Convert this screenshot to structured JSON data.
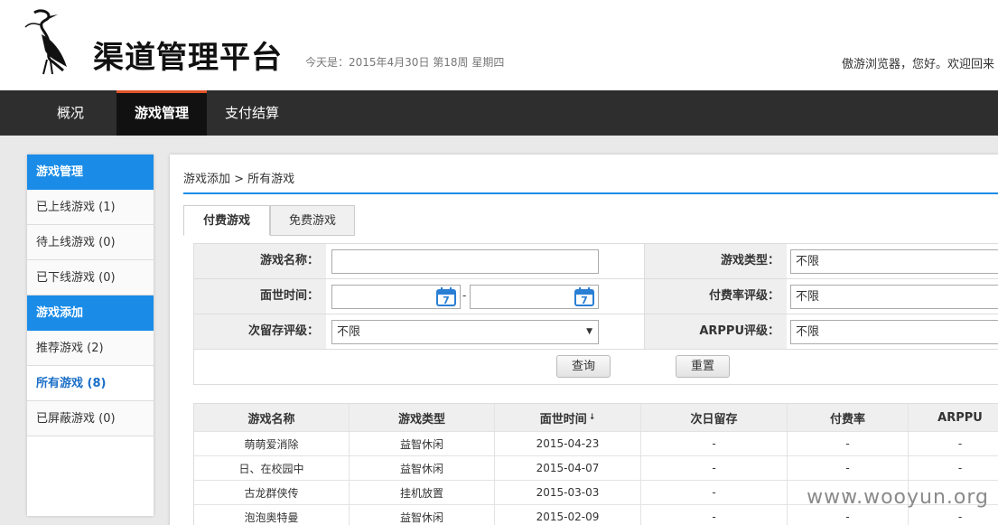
{
  "header": {
    "app_title": "渠道管理平台",
    "date_text": "今天是：2015年4月30日 第18周 星期四",
    "welcome": "傲游浏览器，您好。欢迎回来"
  },
  "nav": [
    {
      "label": "概况",
      "active": false
    },
    {
      "label": "游戏管理",
      "active": true
    },
    {
      "label": "支付结算",
      "active": false
    }
  ],
  "sidebar": {
    "sections": [
      {
        "title": "游戏管理",
        "items": [
          {
            "label": "已上线游戏 (1)"
          },
          {
            "label": "待上线游戏 (0)"
          },
          {
            "label": "已下线游戏 (0)"
          }
        ]
      },
      {
        "title": "游戏添加",
        "items": [
          {
            "label": "推荐游戏 (2)"
          },
          {
            "label": "所有游戏 (8)",
            "active": true
          },
          {
            "label": "已屏蔽游戏 (0)"
          }
        ]
      }
    ]
  },
  "breadcrumb": "游戏添加 > 所有游戏",
  "tabs": [
    {
      "label": "付费游戏",
      "active": true
    },
    {
      "label": "免费游戏",
      "active": false
    }
  ],
  "filter": {
    "game_name_label": "游戏名称：",
    "game_name_value": "",
    "release_time_label": "面世时间：",
    "date_sep": "-",
    "calendar_day": "7",
    "retention_label": "次留存评级：",
    "retention_value": "不限",
    "game_type_label": "游戏类型：",
    "game_type_value": "不限",
    "pay_rate_label": "付费率评级：",
    "pay_rate_value": "不限",
    "arppu_label": "ARPPU评级：",
    "arppu_value": "不限",
    "query_label": "查询",
    "reset_label": "重置"
  },
  "table": {
    "columns": [
      "游戏名称",
      "游戏类型",
      "面世时间",
      "次日留存",
      "付费率",
      "ARPPU"
    ],
    "sort_icon": "↓",
    "rows": [
      [
        "萌萌爱消除",
        "益智休闲",
        "2015-04-23",
        "-",
        "-",
        "-"
      ],
      [
        "日、在校园中",
        "益智休闲",
        "2015-04-07",
        "-",
        "-",
        "-"
      ],
      [
        "古龙群侠传",
        "挂机放置",
        "2015-03-03",
        "-",
        "-",
        "-"
      ],
      [
        "泡泡奥特曼",
        "益智休闲",
        "2015-02-09",
        "-",
        "-",
        "-"
      ]
    ]
  },
  "watermark": "www.wooyun.org",
  "colors": {
    "accent": "#1a8ce8",
    "nav_bg": "#2e2e2e",
    "nav_active_border": "#e0542a"
  }
}
